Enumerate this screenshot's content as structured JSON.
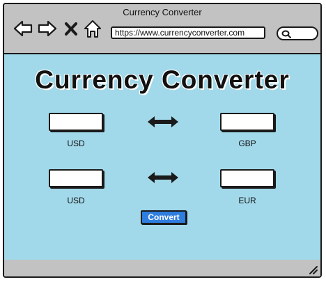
{
  "window": {
    "title": "Currency Converter"
  },
  "toolbar": {
    "back_icon": "back-arrow-icon",
    "forward_icon": "forward-arrow-icon",
    "close_icon": "close-icon",
    "home_icon": "home-icon",
    "search_icon": "search-icon"
  },
  "address_bar": {
    "url": "https://www.currencyconverter.com"
  },
  "page": {
    "title": "Currency Converter"
  },
  "converters": [
    {
      "from_currency": "USD",
      "to_currency": "GBP",
      "from_value": "",
      "to_value": ""
    },
    {
      "from_currency": "USD",
      "to_currency": "EUR",
      "from_value": "",
      "to_value": ""
    }
  ],
  "convert_button": {
    "label": "Convert"
  },
  "colors": {
    "content_background": "#a1d9ea",
    "chrome": "#c2c2c2",
    "button": "#2f7ddf"
  }
}
